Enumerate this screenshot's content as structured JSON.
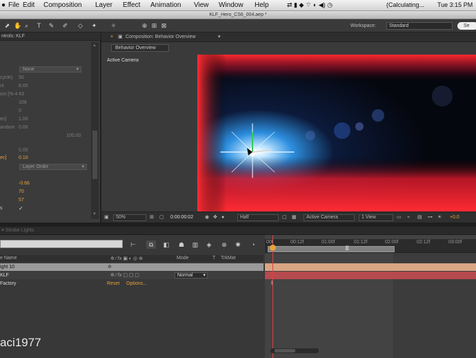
{
  "menubar": {
    "app": "File",
    "items": [
      "Edit",
      "Composition",
      "Layer",
      "Effect",
      "Animation",
      "View",
      "Window",
      "Help"
    ],
    "status_calc": "(Calculating...",
    "clock": "Tue 3:15 PM"
  },
  "window": {
    "title": "KLF_Hero_CS6_004.aep *"
  },
  "toolbar": {
    "workspace_label": "Workspace:",
    "workspace_value": "Standard",
    "search_placeholder": "Se"
  },
  "effect_controls": {
    "tab_label": "ntrols: KLF",
    "select_top": "None",
    "rows": [
      {
        "label": "cycle)",
        "value": "50"
      },
      {
        "label": "nl",
        "value": "8.00"
      },
      {
        "label": "ion [% 4",
        "value": "43"
      },
      {
        "label": "",
        "value": "109"
      },
      {
        "label": "",
        "value": "0"
      },
      {
        "label": "ec]",
        "value": "1.00"
      },
      {
        "label": "andom",
        "value": "0.00"
      },
      {
        "label": "",
        "value": "100.00"
      },
      {
        "label": "",
        "value": "0.00"
      },
      {
        "label": "ec]",
        "value": "0.10"
      }
    ],
    "select_order": "Layer Order",
    "highlight_values": [
      "-0.66",
      "70",
      "57"
    ],
    "check_label": "s",
    "check_mark": "✓"
  },
  "composition": {
    "tab_label": "Composition: Behavior Overview",
    "subtab": "Behavior Overview",
    "view_label": "Active Camera",
    "bottom": {
      "zoom": "50%",
      "timecode": "0:00:00:02",
      "resolution": "Half",
      "camera": "Active Camera",
      "views": "1 View",
      "exposure": "+0.0"
    }
  },
  "timeline": {
    "tab_label": "Strobe Lights",
    "header": {
      "name": "e Name",
      "mode": "Mode",
      "t": "T",
      "trkmat": "TrkMat"
    },
    "layers": [
      {
        "name": "ight 10",
        "mode": ""
      },
      {
        "name": "KLF",
        "mode": "Normal"
      },
      {
        "name": "Factory",
        "effect_reset": "Reset",
        "effect_options": "Options..."
      }
    ],
    "ruler_ticks": [
      "00f",
      "00:12f",
      "01:00f",
      "01:12f",
      "02:00f",
      "02:12f",
      "03:00f"
    ]
  },
  "watermark": "aci1977",
  "colors": {
    "accent": "#e8a23a",
    "panel": "#3a3a3a",
    "layer_peach": "#d9a583",
    "layer_red": "#b64a4e"
  }
}
